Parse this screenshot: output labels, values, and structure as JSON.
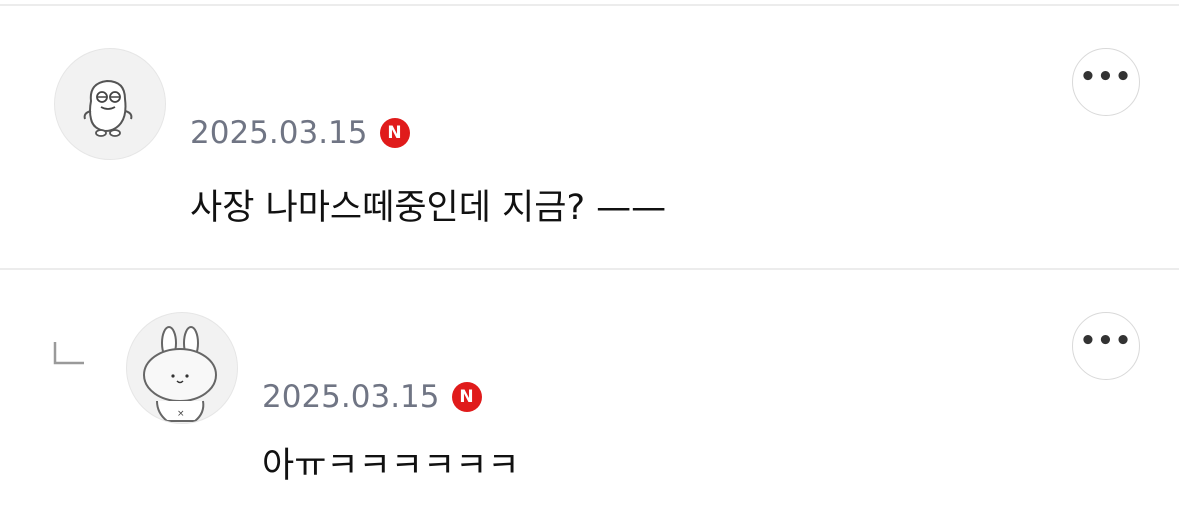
{
  "comments": [
    {
      "username": "   ",
      "date": "2025.03.15",
      "badge": "N",
      "text": "사장 나마스떼중인데 지금? ——",
      "avatar_icon": "character-face-icon",
      "more_label": "•••"
    },
    {
      "username": "  ",
      "date": "2025.03.15",
      "badge": "N",
      "text": "아ㅠㅋㅋㅋㅋㅋㅋ",
      "avatar_icon": "bunny-icon",
      "more_label": "•••",
      "is_reply": true
    }
  ],
  "colors": {
    "badge": "#e01b1b",
    "date": "#707584",
    "divider": "#ececec"
  }
}
